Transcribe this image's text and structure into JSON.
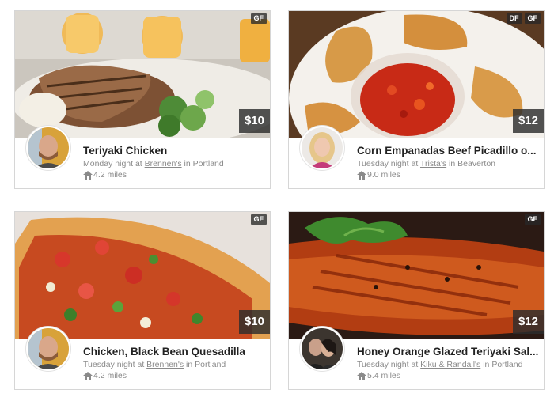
{
  "meals": [
    {
      "title": "Teriyaki Chicken",
      "when": "Monday night at",
      "host_place": "Brennen's",
      "in_text": "in",
      "city": "Portland",
      "distance": "4.2 miles",
      "price": "$10",
      "badges": [
        "GF"
      ],
      "avatar": "bald-man-avatar",
      "photo": "teriyaki-chicken-photo"
    },
    {
      "title": "Corn Empanadas Beef Picadillo o...",
      "when": "Tuesday night at",
      "host_place": "Trista's",
      "in_text": "in",
      "city": "Beaverton",
      "distance": "9.0 miles",
      "price": "$12",
      "badges": [
        "DF",
        "GF"
      ],
      "avatar": "blonde-woman-avatar",
      "photo": "empanadas-photo"
    },
    {
      "title": "Chicken, Black Bean Quesadilla",
      "when": "Tuesday night at",
      "host_place": "Brennen's",
      "in_text": "in",
      "city": "Portland",
      "distance": "4.2 miles",
      "price": "$10",
      "badges": [
        "GF"
      ],
      "avatar": "bald-man-avatar",
      "photo": "quesadilla-photo"
    },
    {
      "title": "Honey Orange Glazed Teriyaki Sal...",
      "when": "Tuesday night at",
      "host_place": "Kiku & Randall's",
      "in_text": "in",
      "city": "Portland",
      "distance": "5.4 miles",
      "price": "$12",
      "badges": [
        "GF"
      ],
      "avatar": "couple-avatar",
      "photo": "glazed-salmon-photo"
    }
  ],
  "icons": {
    "distance": "home-icon"
  }
}
